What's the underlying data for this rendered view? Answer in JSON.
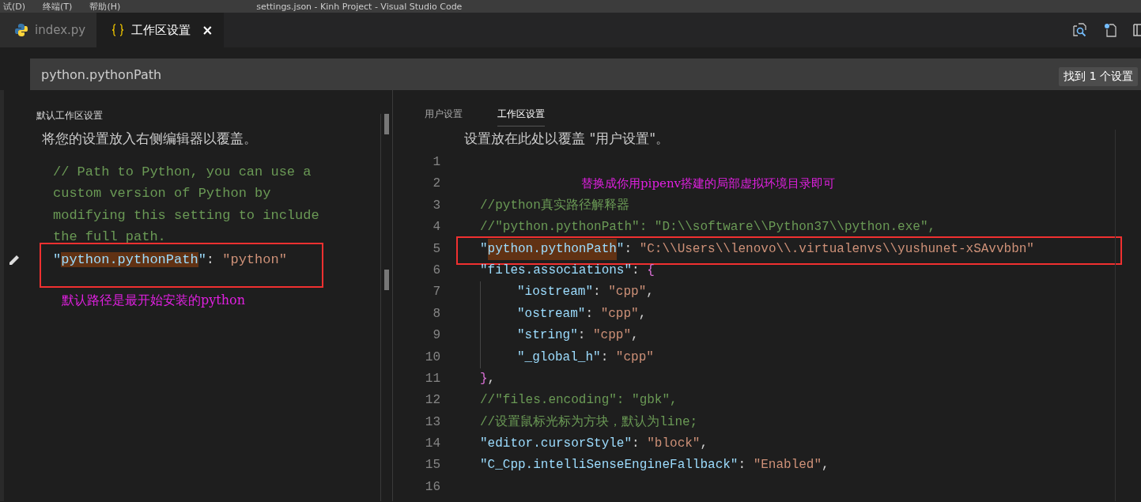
{
  "title_bar": {
    "menus": [
      "试(D)",
      "终端(T)",
      "帮助(H)"
    ],
    "title": "settings.json - Kinh Project - Visual Studio Code"
  },
  "tabs": [
    {
      "label": "index.py",
      "selected": false
    },
    {
      "label": "工作区设置",
      "selected": true,
      "close": "×"
    }
  ],
  "search": {
    "value": "python.pythonPath",
    "result": "找到 1 个设置"
  },
  "default_panel": {
    "header": "默认工作区设置",
    "description": "将您的设置放入右侧编辑器以覆盖。",
    "comment_lines": [
      "// Path to Python, you can use a",
      "custom version of Python by",
      "modifying this setting to include",
      "the full path."
    ],
    "setting": {
      "boxed": true,
      "tokens": [
        {
          "kind": "key",
          "text": "\""
        },
        {
          "kind": "key",
          "text": "python.pythonPath",
          "highlighted": true
        },
        {
          "kind": "key",
          "text": "\""
        },
        {
          "kind": "punct",
          "text": ": "
        },
        {
          "kind": "string",
          "text": "\"python\""
        }
      ]
    },
    "note": "默认路径是最开始安装的python"
  },
  "editor": {
    "tabs": [
      {
        "label": "用户设置",
        "selected": false
      },
      {
        "label": "工作区设置",
        "selected": true
      }
    ],
    "description": "设置放在此处以覆盖 \"用户设置\"。",
    "lines": [
      {
        "number": "1"
      },
      {
        "number": "2",
        "tokens": [
          {
            "kind": "note",
            "text": "替换成你用pipenv搭建的局部虚拟环境目录即可"
          }
        ]
      },
      {
        "number": "3",
        "tokens": [
          {
            "kind": "comment",
            "text": "//python真实路径解释器"
          }
        ]
      },
      {
        "number": "4",
        "tokens": [
          {
            "kind": "comment",
            "text": "//\"python.pythonPath\": \"D:\\\\software\\\\Python37\\\\python.exe\","
          }
        ]
      },
      {
        "number": "5",
        "boxed": true,
        "tokens": [
          {
            "kind": "key",
            "text": "\""
          },
          {
            "kind": "key",
            "text": "python.pythonPath",
            "highlighted": true
          },
          {
            "kind": "key",
            "text": "\""
          },
          {
            "kind": "punct",
            "text": ": "
          },
          {
            "kind": "string",
            "text": "\"C:\\\\Users\\\\lenovo\\\\.virtualenvs\\\\yushunet-xSAvvbbn\""
          }
        ]
      },
      {
        "number": "6",
        "tokens": [
          {
            "kind": "key",
            "text": "\"files.associations\""
          },
          {
            "kind": "punct",
            "text": ": "
          },
          {
            "kind": "bracket",
            "text": "{"
          }
        ],
        "children": [
          {
            "number": "7",
            "tokens": [
              {
                "kind": "key",
                "text": "\"iostream\""
              },
              {
                "kind": "punct",
                "text": ": "
              },
              {
                "kind": "string",
                "text": "\"cpp\""
              },
              {
                "kind": "punct",
                "text": ","
              }
            ]
          },
          {
            "number": "8",
            "tokens": [
              {
                "kind": "key",
                "text": "\"ostream\""
              },
              {
                "kind": "punct",
                "text": ": "
              },
              {
                "kind": "string",
                "text": "\"cpp\""
              },
              {
                "kind": "punct",
                "text": ","
              }
            ]
          },
          {
            "number": "9",
            "tokens": [
              {
                "kind": "key",
                "text": "\"string\""
              },
              {
                "kind": "punct",
                "text": ": "
              },
              {
                "kind": "string",
                "text": "\"cpp\""
              },
              {
                "kind": "punct",
                "text": ","
              }
            ]
          },
          {
            "number": "10",
            "tokens": [
              {
                "kind": "key",
                "text": "\"_global_h\""
              },
              {
                "kind": "punct",
                "text": ": "
              },
              {
                "kind": "string",
                "text": "\"cpp\""
              }
            ]
          }
        ]
      },
      {
        "number": "11",
        "tokens": [
          {
            "kind": "bracket",
            "text": "}"
          },
          {
            "kind": "punct",
            "text": ","
          }
        ]
      },
      {
        "number": "12",
        "tokens": [
          {
            "kind": "comment",
            "text": "//\"files.encoding\": \"gbk\","
          }
        ]
      },
      {
        "number": "13",
        "tokens": [
          {
            "kind": "comment",
            "text": "//设置鼠标光标为方块，默认为line;"
          }
        ]
      },
      {
        "number": "14",
        "tokens": [
          {
            "kind": "key",
            "text": "\"editor.cursorStyle\""
          },
          {
            "kind": "punct",
            "text": ": "
          },
          {
            "kind": "string",
            "text": "\"block\""
          },
          {
            "kind": "punct",
            "text": ","
          }
        ]
      },
      {
        "number": "15",
        "tokens": [
          {
            "kind": "key",
            "text": "\"C_Cpp.intelliSenseEngineFallback\""
          },
          {
            "kind": "punct",
            "text": ": "
          },
          {
            "kind": "string",
            "text": "\"Enabled\""
          },
          {
            "kind": "punct",
            "text": ","
          }
        ]
      },
      {
        "number": "16"
      }
    ]
  }
}
